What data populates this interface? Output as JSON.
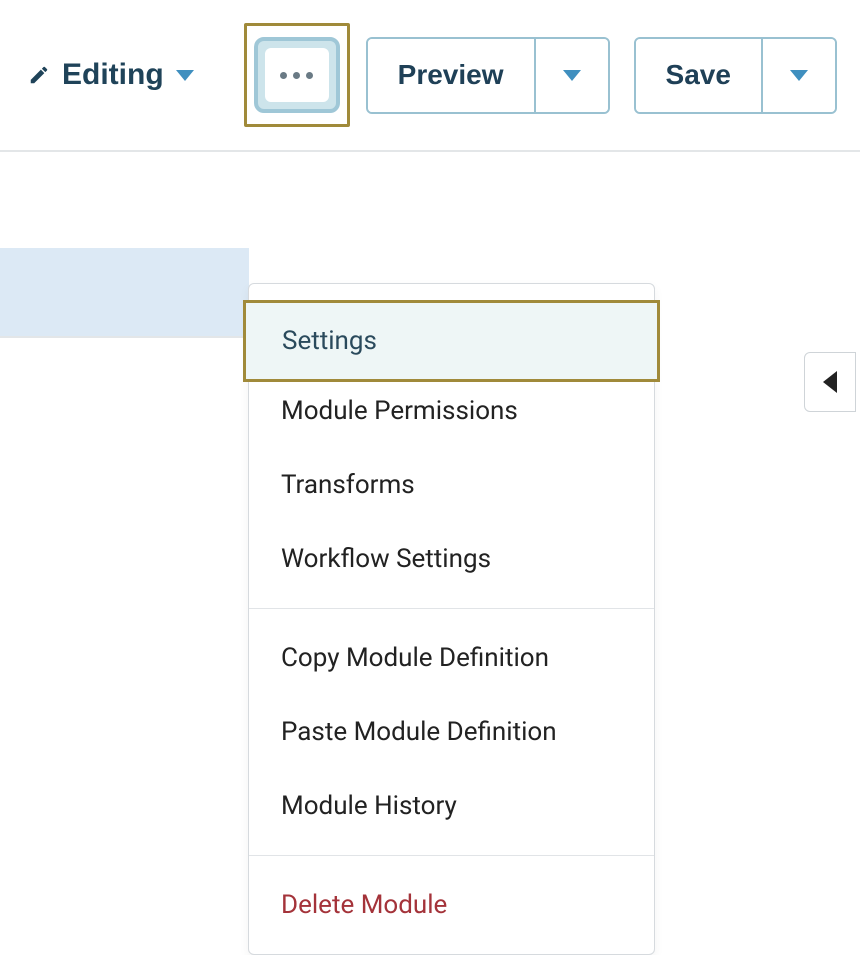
{
  "toolbar": {
    "mode_label": "Editing",
    "preview_label": "Preview",
    "save_label": "Save"
  },
  "menu": {
    "settings": "Settings",
    "permissions": "Module Permissions",
    "transforms": "Transforms",
    "workflow": "Workflow Settings",
    "copy": "Copy Module Definition",
    "paste": "Paste Module Definition",
    "history": "Module History",
    "delete": "Delete Module"
  },
  "colors": {
    "highlight_border": "#a08a3a",
    "button_border": "#99c1d1",
    "text_primary": "#1f4359",
    "danger": "#a4333a"
  }
}
